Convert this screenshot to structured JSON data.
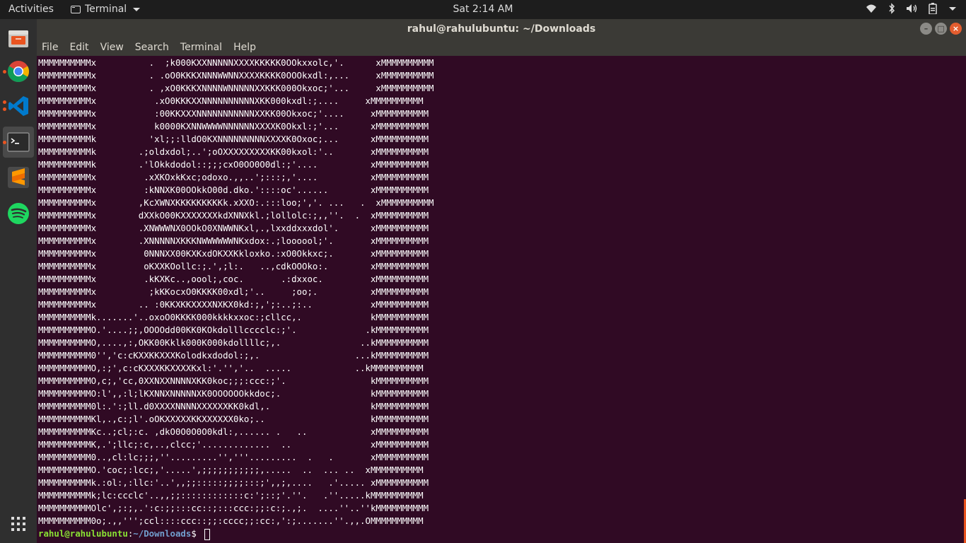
{
  "topbar": {
    "activities": "Activities",
    "app_menu": "Terminal",
    "clock": "Sat  2:14 AM",
    "icons": [
      "wifi-icon",
      "bluetooth-icon",
      "volume-icon",
      "battery-icon",
      "caret-icon"
    ]
  },
  "dock": {
    "apps": [
      "Files",
      "Google Chrome",
      "Visual Studio Code",
      "Terminal",
      "Sublime Text",
      "Spotify",
      "Show Applications"
    ],
    "accent": "#e95420"
  },
  "window": {
    "title": "rahul@rahulubuntu: ~/Downloads",
    "menu": [
      "File",
      "Edit",
      "View",
      "Search",
      "Terminal",
      "Help"
    ]
  },
  "terminal": {
    "background": "#300a24",
    "lines": [
      "MMMMMMMMMMx          .  ;k000KXXNNNNNXXXXKKKKK0OOkxxolc,'.      xMMMMMMMMMM",
      "MMMMMMMMMMx          . .oO0KKKXNNNWWNNXXXXKKKK0OOOkxdl:,...     xMMMMMMMMMM",
      "MMMMMMMMMMx          . ,xO0KKKXNNNNWNNNNNXXKKK000Okxoc;'...     xMMMMMMMMMM",
      "MMMMMMMMMMx           .xO0KKKXXNNNNNNNNNNXKK000kxdl:;....     xMMMMMMMMMM",
      "MMMMMMMMMMx           :00KKXXXNNNNNNNNNNNXXKK00Okxoc;'....     xMMMMMMMMMM",
      "MMMMMMMMMMx           k0000KXNNWWWWNNNNNNXXXXK0Okxl:;'...      xMMMMMMMMMM",
      "MMMMMMMMMMk          'xl;;:lldO0KXNNNNNNNNNXXXXK0Oxoc;...      xMMMMMMMMMM",
      "MMMMMMMMMMk        .;oldxdol;..';oOXXXXXXXXXKK00kxol:'..       xMMMMMMMMMM",
      "MMMMMMMMMMk        .'lOkkdodol::;;;cxO0OO0O0dl:;'....          xMMMMMMMMMM",
      "MMMMMMMMMMx         .xXKOxkKxc;odoxo.,,..';:::;,'....          xMMMMMMMMMM",
      "MMMMMMMMMMx         :kNNXK00OOkkO00d.dko.'::::oc'......        xMMMMMMMMMM",
      "MMMMMMMMMMx        ,KcXWNXKKKKKKKKKk.xXXO:.:::loo;','. ...   .  xMMMMMMMMMM",
      "MMMMMMMMMMx        dXXkO00KXXXXXXXkdXNNXkl.;lollolc:;,,''.  .  xMMMMMMMMMM",
      "MMMMMMMMMMx        .XNWWWNX0OOkO0XNWWNKxl,.,lxxddxxxdol'.      xMMMMMMMMMM",
      "MMMMMMMMMMx        .XNNNNNXKKKNWWWWWWNKxdox:.;loooool;'.       xMMMMMMMMMM",
      "MMMMMMMMMMx         0NNNXX00KXKxdOKXXKkloxko.:xO0Okkxc;.       xMMMMMMMMMM",
      "MMMMMMMMMMx         oKXXKOollc:;.',;l:.   ..,cdkOOOko:.        xMMMMMMMMMM",
      "MMMMMMMMMMx         .kKXKc..,oool;,coc.       .:dxxoc.         xMMMMMMMMMM",
      "MMMMMMMMMMx          ;kKKocxO0KKKK00xdl;'..     ;oo;.          xMMMMMMMMMM",
      "MMMMMMMMMMx        .. :0KKXKKXXXXNXKX0kd:;,';:..;:..           xMMMMMMMMMM",
      "MMMMMMMMMMk.......'..oxoO0KKKK000kkkkxxoc:;cllcc,.             kMMMMMMMMMM",
      "MMMMMMMMMMO.'....;;,OOOOdd00KK0KOkdolllcccclc:;'.             .kMMMMMMMMMM",
      "MMMMMMMMMMO,....,:,OKK00Kklk000K000kdollllc;,.               ..kMMMMMMMMMM",
      "MMMMMMMMMM0'','c:cKXXKKXXXKolodkxdodol:;,.                  ...kMMMMMMMMMM",
      "MMMMMMMMMMO,:;',c:cKXXXKKXXXXKxl:'.'','..  .....            ..kMMMMMMMMMM",
      "MMMMMMMMMMO,c;,'cc,0XXNXXNNNNXKK0koc;;;:ccc:;'.                kMMMMMMMMMM",
      "MMMMMMMMMMO:l',,:l;lKXNNXNNNNNXK0OOOOOOkkdoc;.                 kMMMMMMMMMM",
      "MMMMMMMMMM0l:.':;ll.d0XXXXNNNNXXXXXXKK0kdl,.                   kMMMMMMMMMM",
      "MMMMMMMMMMKl,.,c:;l'.oOKXXXXXKKXXXXXX0ko;..                    kMMMMMMMMMM",
      "MMMMMMMMMMKc..;cl;:c. ,dkO0O0O0O0kdl:,...... .   ..            xMMMMMMMMMM",
      "MMMMMMMMMMK,.';llc;:c,..,clcc;'.............  ..               xMMMMMMMMMM",
      "MMMMMMMMMM0..,cl:lc;;;,''.........'','''.........  .   .       xMMMMMMMMMM",
      "MMMMMMMMMMO.'coc;:lcc;,'.....',;;;;;;;;;;;,.....  ..  ... ..  xMMMMMMMMMM",
      "MMMMMMMMMMk.:ol:,:llc:'..',,;;:::::;;;;:::;',,;,....   .'..... xMMMMMMMMMM",
      "MMMMMMMMMMk;lc:ccclc'..,,;;::::::::::::c:';::;'.''.   .''.....kMMMMMMMMMM",
      "MMMMMMMMMMOlc',;:;,.':c:;;:::cc::;:::ccc:;;:c:;.,;.  ....''..''kMMMMMMMMMM",
      "MMMMMMMMMM0o;.,,''';ccl::::ccc::;;:cccc;;:cc:,':;.......''.,,.OMMMMMMMMMM"
    ],
    "prompt": {
      "user": "rahul@rahulubuntu",
      "colon": ":",
      "path": "~/Downloads",
      "dollar": "$ "
    }
  }
}
